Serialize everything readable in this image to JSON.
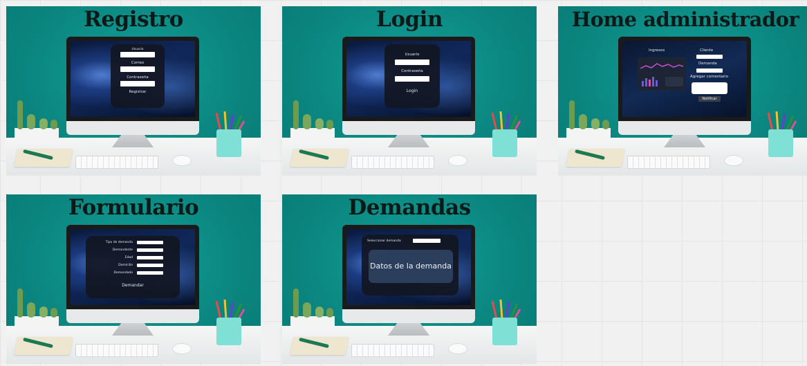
{
  "cards": {
    "registro": {
      "title": "Registro",
      "fields": [
        "Usuario",
        "Correo",
        "Contraseña"
      ],
      "button": "Registrar"
    },
    "login": {
      "title": "Login",
      "fields": [
        "Usuario",
        "Contraseña"
      ],
      "button": "Login"
    },
    "home": {
      "title": "Home administrador",
      "ingresos_label": "Ingresos",
      "cliente_label": "Cliente",
      "demanda_label": "Demanda",
      "agregar_label": "Agregar comentario",
      "notificar_button": "Notificar"
    },
    "formulario": {
      "title": "Formulario",
      "rows": [
        "Tipo de demanda",
        "Demandante",
        "Edad",
        "Domicilio",
        "Demandado"
      ],
      "button": "Demandar"
    },
    "demandas": {
      "title": "Demandas",
      "select_label": "Seleccionar demanda",
      "datos_label": "Datos de la demanda"
    }
  },
  "colors": {
    "wall": "#0c8b85",
    "panel": "#12162a",
    "chart_bar": "#6b5bd6",
    "chart_line": "#c24fd8"
  }
}
